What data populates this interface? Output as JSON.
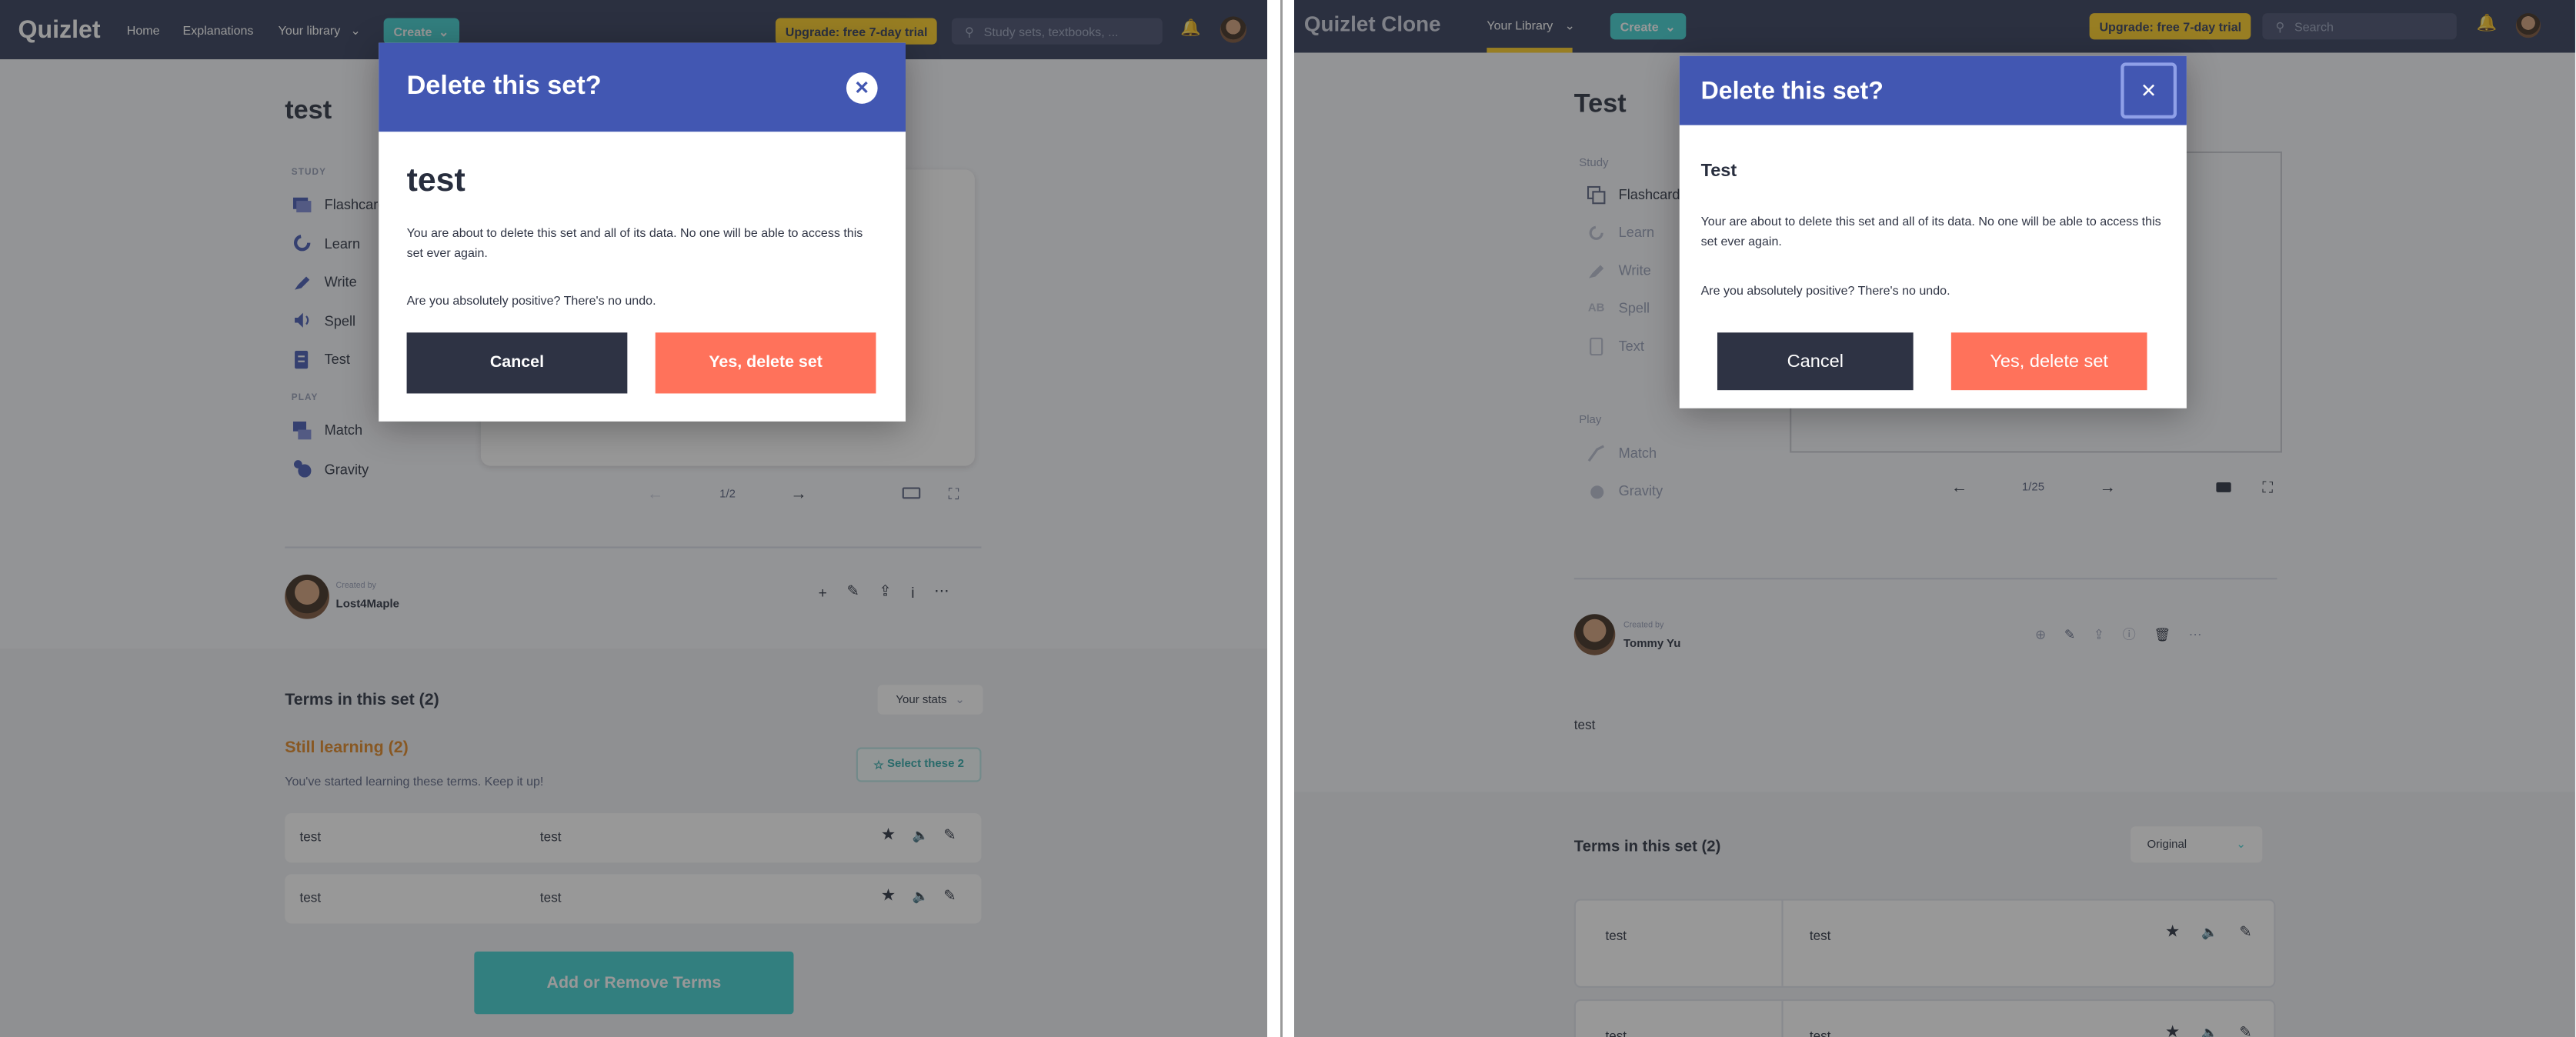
{
  "left": {
    "nav": {
      "logo": "Quizlet",
      "links": [
        "Home",
        "Explanations",
        "Your library"
      ],
      "create": "Create",
      "upgrade": "Upgrade: free 7-day trial",
      "search_placeholder": "Study sets, textbooks, ..."
    },
    "set_title": "test",
    "study_label": "STUDY",
    "study_items": [
      "Flashcards",
      "Learn",
      "Write",
      "Spell",
      "Test"
    ],
    "play_label": "PLAY",
    "play_items": [
      "Match",
      "Gravity"
    ],
    "pager": "1/2",
    "created_by_label": "Created by",
    "author": "Lost4Maple",
    "terms_heading": "Terms in this set (2)",
    "stats_dropdown": "Your stats",
    "still_learning": "Still learning (2)",
    "still_learning_sub": "You've started learning these terms. Keep it up!",
    "select_these": "Select these 2",
    "terms": [
      {
        "term": "test",
        "definition": "test"
      },
      {
        "term": "test",
        "definition": "test"
      }
    ],
    "add_remove": "Add or Remove Terms",
    "modal": {
      "title": "Delete this set?",
      "set_name": "test",
      "body": "You are about to delete this set and all of its data. No one will be able to access this set ever again.",
      "confirm_question": "Are you absolutely positive? There's no undo.",
      "cancel": "Cancel",
      "delete": "Yes, delete set"
    }
  },
  "right": {
    "nav": {
      "logo": "Quizlet Clone",
      "library": "Your Library",
      "create": "Create",
      "upgrade": "Upgrade: free 7-day trial",
      "search_placeholder": "Search"
    },
    "set_title": "Test",
    "study_label": "Study",
    "study_items": [
      "Flashcards",
      "Learn",
      "Write",
      "Spell",
      "Text"
    ],
    "play_label": "Play",
    "play_items": [
      "Match",
      "Gravity"
    ],
    "pager": "1/25",
    "created_by_label": "Created by",
    "author": "Tommy Yu",
    "description": "test",
    "terms_heading": "Terms in this set (2)",
    "sort_dropdown": "Original",
    "terms": [
      {
        "term": "test",
        "definition": "test"
      },
      {
        "term": "test",
        "definition": "test"
      }
    ],
    "modal": {
      "title": "Delete this set?",
      "set_name": "Test",
      "body": "Your are about to delete this set and all of its data. No one will be able to access this set ever again.",
      "confirm_question": "Are you absolutely positive? There's no undo.",
      "cancel": "Cancel",
      "delete": "Yes, delete set"
    }
  },
  "colors": {
    "nav": "#2e3856",
    "create": "#3ccfcf",
    "upgrade": "#ffcd1f",
    "modal_header": "#4257b2",
    "cancel": "#2e3344",
    "delete": "#ff725b",
    "still_learning": "#e0841f",
    "teal_button": "#3ccfcf"
  }
}
